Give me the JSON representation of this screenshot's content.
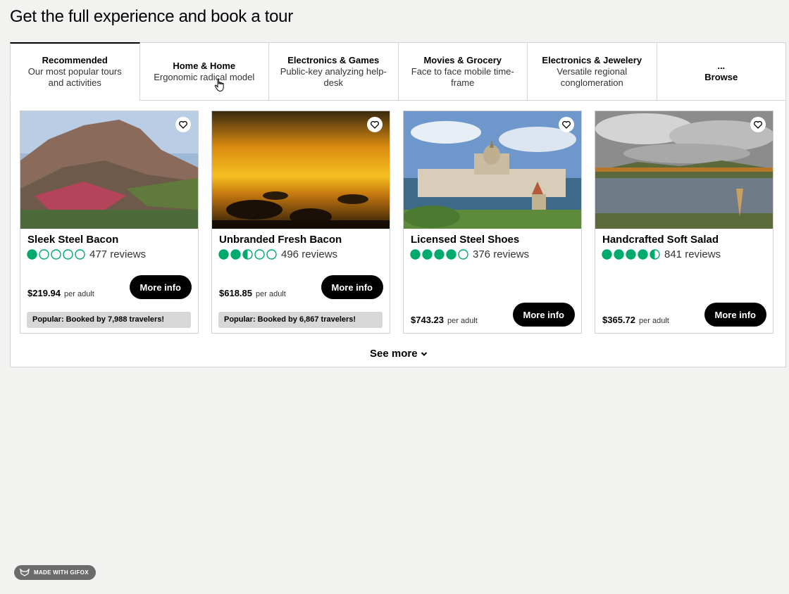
{
  "page_title": "Get the full experience and book a tour",
  "tabs": [
    {
      "title": "Recommended",
      "subtitle": "Our most popular tours and activities"
    },
    {
      "title": "Home & Home",
      "subtitle": "Ergonomic radical model"
    },
    {
      "title": "Electronics & Games",
      "subtitle": "Public-key analyzing help-desk"
    },
    {
      "title": "Movies & Grocery",
      "subtitle": "Face to face mobile time-frame"
    },
    {
      "title": "Electronics & Jewelery",
      "subtitle": "Versatile regional conglomeration"
    },
    {
      "title": "...",
      "subtitle": "Browse"
    }
  ],
  "cards": [
    {
      "title": "Sleek Steel Bacon",
      "rating": 1,
      "reviews": "477 reviews",
      "price": "$219.94",
      "per": "per adult",
      "button": "More info",
      "popular": "Popular: Booked by 7,988 travelers!"
    },
    {
      "title": "Unbranded Fresh Bacon",
      "rating": 2.5,
      "reviews": "496 reviews",
      "price": "$618.85",
      "per": "per adult",
      "button": "More info",
      "popular": "Popular: Booked by 6,867 travelers!"
    },
    {
      "title": "Licensed Steel Shoes",
      "rating": 4,
      "reviews": "376 reviews",
      "price": "$743.23",
      "per": "per adult",
      "button": "More info",
      "popular": ""
    },
    {
      "title": "Handcrafted Soft Salad",
      "rating": 4.5,
      "reviews": "841 reviews",
      "price": "$365.72",
      "per": "per adult",
      "button": "More info",
      "popular": ""
    }
  ],
  "see_more": "See more",
  "badge": "MADE WITH GIFOX",
  "colors": {
    "rating_green": "#00aa6c",
    "button_bg": "#000000",
    "popular_bg": "#d7d7d7"
  }
}
